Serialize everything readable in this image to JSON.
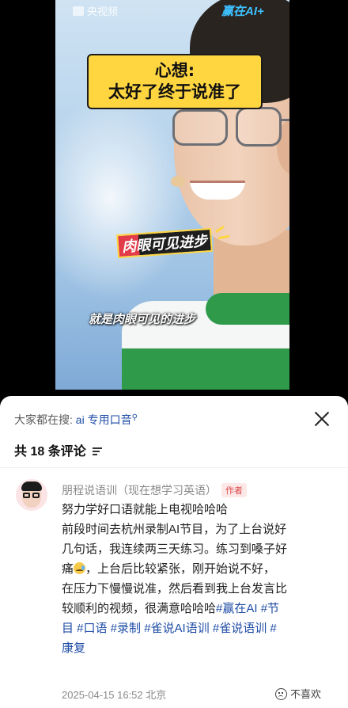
{
  "video": {
    "channel_logo": "央视频",
    "brand_logo": "赢在AI+",
    "thought_line1": "心想:",
    "thought_line2": "太好了终于说准了",
    "sticker": "肉眼可见进步",
    "subtitle": "就是肉眼可见的进步"
  },
  "search": {
    "prefix": "大家都在搜:",
    "keyword": "ai 专用口音",
    "icon": "search-icon"
  },
  "comments": {
    "count_label": "共 18 条评论",
    "sort_icon": "sort-icon",
    "close_icon": "close-icon"
  },
  "comment": {
    "author": "朋程说语训（现在想学习英语）",
    "author_badge": "作者",
    "lines": {
      "l1": "努力学好口语就能上电视哈哈哈",
      "l2": "前段时间去杭州录制AI节目，为了上台说好",
      "l3": "几句话，我连续两三天练习。练习到嗓子好",
      "l4a": "痛",
      "l4b": "，上台后比较紧张，刚开始说不好，",
      "l5": "在压力下慢慢说准，然后看到我上台发言比",
      "l6a": "较顺利的视频，很满意哈哈哈",
      "l6b": "#赢在AI #节",
      "l7": "目 #口语 #录制 #雀说AI语训 #雀说语训 #",
      "l8": "康复"
    },
    "timestamp": "2025-04-15 16:52",
    "location": "北京",
    "dislike_label": "不喜欢"
  }
}
